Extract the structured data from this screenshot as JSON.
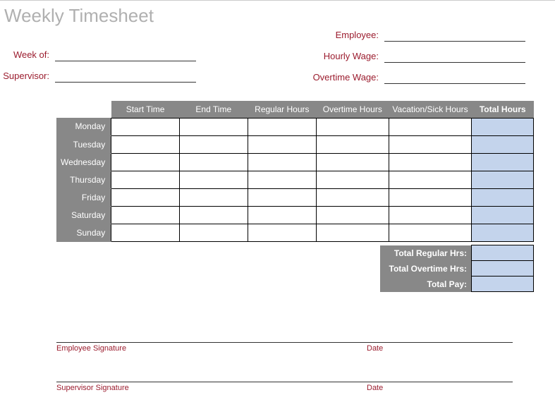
{
  "title": "Weekly Timesheet",
  "fields": {
    "week_of": "Week of:",
    "supervisor": "Supervisor:",
    "employee": "Employee:",
    "hourly_wage": "Hourly Wage:",
    "overtime_wage": "Overtime Wage:"
  },
  "table": {
    "headers": {
      "start_time": "Start Time",
      "end_time": "End Time",
      "regular_hours": "Regular Hours",
      "overtime_hours": "Overtime Hours",
      "vacation_sick": "Vacation/Sick Hours",
      "total_hours": "Total Hours"
    },
    "days": [
      "Monday",
      "Tuesday",
      "Wednesday",
      "Thursday",
      "Friday",
      "Saturday",
      "Sunday"
    ]
  },
  "totals": {
    "regular": "Total Regular Hrs:",
    "overtime": "Total Overtime Hrs:",
    "pay": "Total Pay:"
  },
  "signatures": {
    "employee": "Employee Signature",
    "supervisor": "Supervisor Signature",
    "date": "Date"
  }
}
